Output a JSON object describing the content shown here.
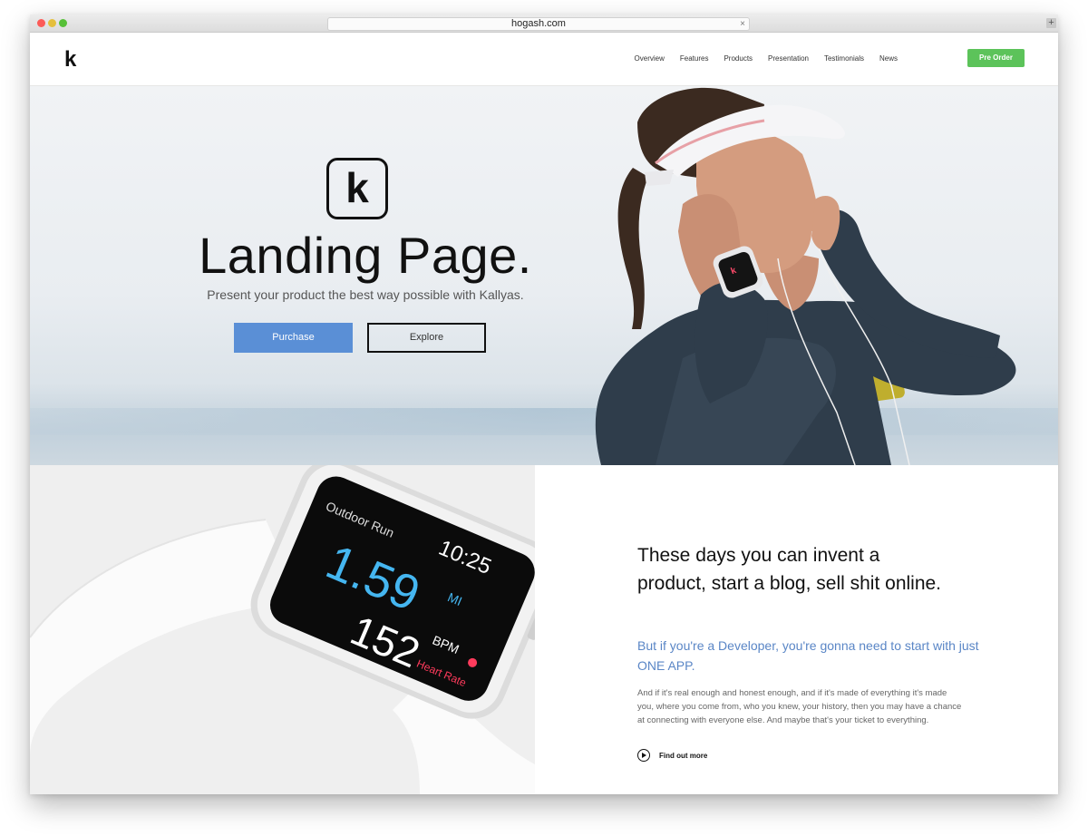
{
  "browser": {
    "url": "hogash.com",
    "close_glyph": "×",
    "newtab_glyph": "+"
  },
  "header": {
    "logo": "k",
    "nav": [
      "Overview",
      "Features",
      "Products",
      "Presentation",
      "Testimonials",
      "News"
    ],
    "cta": "Pre Order"
  },
  "hero": {
    "logo_mark": "k",
    "title": "Landing Page.",
    "subtitle": "Present your product the best way possible with Kallyas.",
    "primary_button": "Purchase",
    "secondary_button": "Explore"
  },
  "watch": {
    "activity": "Outdoor Run",
    "time": "10:25",
    "distance": "1.59",
    "distance_unit": "MI",
    "heart_rate": "152",
    "heart_rate_unit": "BPM",
    "heart_label": "Heart Rate"
  },
  "feature": {
    "headline": "These days you can invent a product, start a blog, sell shit online.",
    "subheadline": "But if you're a Developer, you're gonna need to start with just ONE APP.",
    "body": "And if it's real enough and honest enough, and if it's made of everything it's made you, where you come from, who you knew, your history, then you may have a chance at connecting with everyone else. And maybe that's your ticket to everything.",
    "link": "Find out more"
  },
  "colors": {
    "accent_blue": "#5a8fd6",
    "cta_green": "#5cc35a",
    "subheadline_blue": "#5a86c6"
  }
}
